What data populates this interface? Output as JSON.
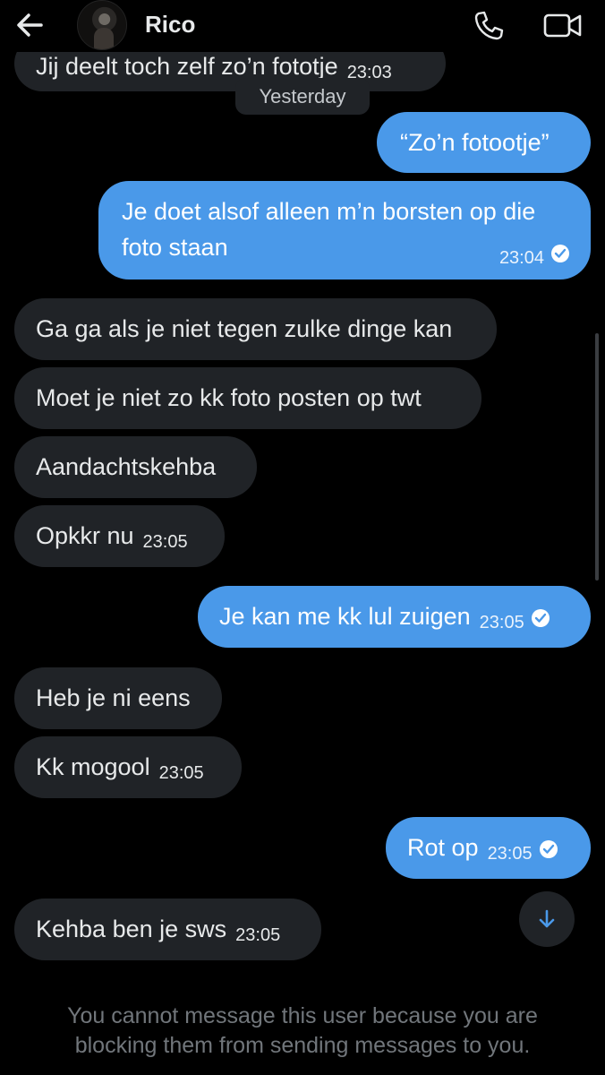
{
  "header": {
    "contact_name": "Rico",
    "icons": [
      "back-arrow-icon",
      "avatar",
      "phone-icon",
      "video-call-icon"
    ]
  },
  "conversation": {
    "partial_top_message": {
      "text": "Jij deelt toch zelf zo’n fototje",
      "time": "23:03"
    },
    "date_divider": "Yesterday",
    "messages": [
      {
        "direction": "out",
        "text": "“Zo’n fotootje”",
        "time": ""
      },
      {
        "direction": "out",
        "text": "Je doet alsof alleen m’n borsten op die foto staan",
        "time": "23:04",
        "read": true
      },
      {
        "direction": "in",
        "text": "Ga ga als je niet tegen zulke dinge kan",
        "time": ""
      },
      {
        "direction": "in",
        "text": "Moet je niet zo kk foto posten op twt",
        "time": ""
      },
      {
        "direction": "in",
        "text": "Aandachtskehba",
        "time": ""
      },
      {
        "direction": "in",
        "text": "Opkkr nu",
        "time": "23:05"
      },
      {
        "direction": "out",
        "text": "Je kan me kk lul zuigen",
        "time": "23:05",
        "read": true
      },
      {
        "direction": "in",
        "text": "Heb je ni eens",
        "time": ""
      },
      {
        "direction": "in",
        "text": "Kk mogool",
        "time": "23:05"
      },
      {
        "direction": "out",
        "text": "Rot op",
        "time": "23:05",
        "read": true
      },
      {
        "direction": "in",
        "text": "Kehba ben je sws",
        "time": "23:05"
      }
    ]
  },
  "footer": {
    "notice_line1": "You cannot message this user because you are",
    "notice_line2": "blocking them from sending messages to you."
  },
  "colors": {
    "background": "#000000",
    "incoming_bubble": "#202327",
    "outgoing_bubble": "#4a99e9",
    "muted_text": "#71767b"
  }
}
